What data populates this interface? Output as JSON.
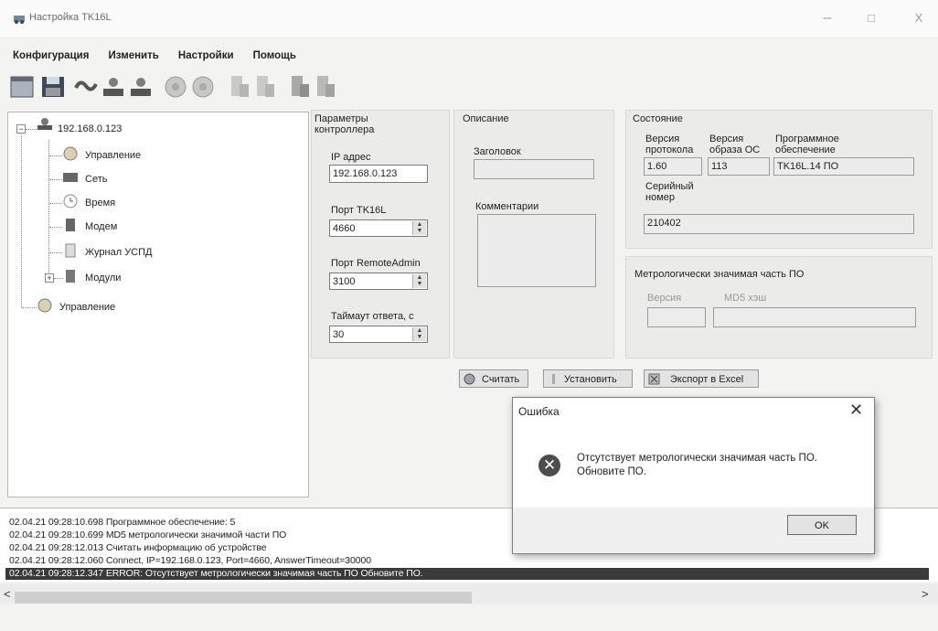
{
  "window": {
    "title": "Настройка TK16L",
    "minimize": "–",
    "maximize": "□",
    "close": "X"
  },
  "menu": [
    "Конфигурация",
    "Изменить",
    "Настройки",
    "Помощь"
  ],
  "toolbar": {
    "icons": [
      "window-icon",
      "save-icon",
      "connect-icon",
      "network-icon",
      "network-icon",
      "globe-icon",
      "globe-icon",
      "device-icon",
      "device-icon",
      "device-icon",
      "device-icon"
    ]
  },
  "tree": {
    "root": "192.168.0.123",
    "children": [
      "Управление",
      "Сеть",
      "Время",
      "Модем",
      "Журнал УСПД",
      "Модули"
    ],
    "second_root": "Управление"
  },
  "params": {
    "title_line1": "Параметры",
    "title_line2": "контроллера",
    "ip_label": "IP адрес",
    "ip_value": "192.168.0.123",
    "port_label": "Порт TK16L",
    "port_value": "4660",
    "remote_label": "Порт RemoteAdmin",
    "remote_value": "3100",
    "timeout_label": "Таймаут ответа, с",
    "timeout_value": "30"
  },
  "description": {
    "title": "Описание",
    "header_label": "Заголовок",
    "header_value": "",
    "comments_label": "Комментарии",
    "comments_value": ""
  },
  "state": {
    "title": "Состояние",
    "proto_label1": "Версия",
    "proto_label2": "протокола",
    "proto_value": "1.60",
    "os_label1": "Версия",
    "os_label2": "образа ОС",
    "os_value": "113",
    "sw_label1": "Программное",
    "sw_label2": "обеспечение",
    "sw_value": "TK16L.14 ПО",
    "serial_label1": "Серийный",
    "serial_label2": "номер",
    "serial_value": "210402"
  },
  "metro": {
    "title": "Метрологически значимая часть ПО",
    "version_label": "Версия",
    "md5_label": "MD5 хэш",
    "version_value": "",
    "md5_value": ""
  },
  "actions": {
    "read": "Считать",
    "set": "Установить",
    "export": "Экспорт в Excel"
  },
  "log": [
    "02.04.21 09:28:10.698 Программное обеспечение: 5",
    "02.04.21 09:28:10.699 MD5  метрологически значимой части ПО",
    "02.04.21 09:28:12.013 Считать информацию об устройстве",
    "02.04.21 09:28:12.060 Connect, IP=192.168.0.123, Port=4660, AnswerTimeout=30000",
    "02.04.21 09:28:12.347 ERROR: Отсутствует метрологически значимая часть ПО Обновите ПО."
  ],
  "scroll": {
    "left": "<",
    "right": ">"
  },
  "dialog": {
    "title": "Ошибка",
    "close": "✕",
    "message_line1": "Отсутствует метрологически значимая часть ПО.",
    "message_line2": "Обновите ПО.",
    "icon": "✕",
    "ok": "OK"
  },
  "colors": {
    "log_error_bg": "#3a3a3a",
    "log_error_fg": "#ffffff",
    "error_icon": "#4d4d4d"
  }
}
